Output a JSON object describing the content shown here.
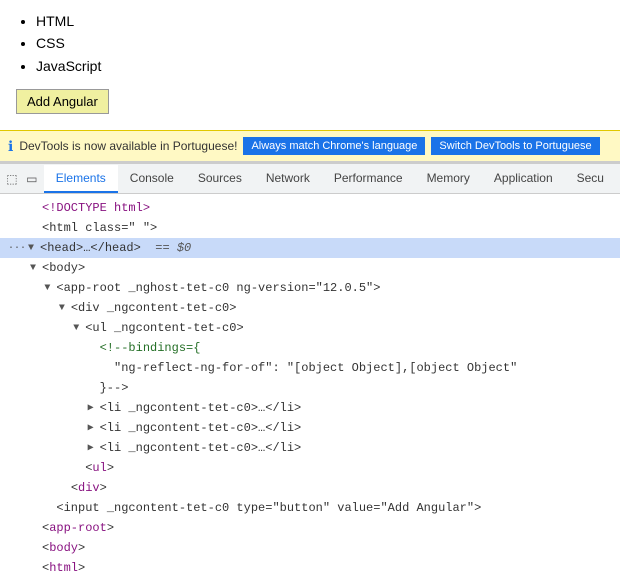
{
  "top": {
    "list_items": [
      "HTML",
      "CSS",
      "JavaScript"
    ],
    "add_button_label": "Add Angular"
  },
  "notification": {
    "text": "DevTools is now available in Portuguese!",
    "btn_match_label": "Always match Chrome's language",
    "btn_switch_label": "Switch DevTools to Portuguese"
  },
  "tabs": {
    "items": [
      "Elements",
      "Console",
      "Sources",
      "Network",
      "Performance",
      "Memory",
      "Application",
      "Secu"
    ]
  },
  "code": {
    "lines": [
      {
        "indent": 0,
        "arrow": "none",
        "content": "<!DOCTYPE html>"
      },
      {
        "indent": 0,
        "arrow": "none",
        "content": "<html class=\" \">"
      },
      {
        "indent": 0,
        "arrow": "expanded",
        "highlight": true,
        "content": "<head>…</head>",
        "suffix": " == $0"
      },
      {
        "indent": 0,
        "arrow": "expanded",
        "content": "<body>"
      },
      {
        "indent": 1,
        "arrow": "expanded",
        "content": "<app-root _nghost-tet-c0 ng-version=\"12.0.5\">"
      },
      {
        "indent": 2,
        "arrow": "expanded",
        "content": "<div _ngcontent-tet-c0>"
      },
      {
        "indent": 3,
        "arrow": "expanded",
        "content": "<ul _ngcontent-tet-c0>"
      },
      {
        "indent": 4,
        "arrow": "none",
        "content": "<!--bindings={"
      },
      {
        "indent": 5,
        "arrow": "none",
        "content": "\"ng-reflect-ng-for-of\": \"[object Object],[object Object\""
      },
      {
        "indent": 4,
        "arrow": "none",
        "content": "}-->"
      },
      {
        "indent": 4,
        "arrow": "collapsed",
        "content": "<li _ngcontent-tet-c0>…</li>"
      },
      {
        "indent": 4,
        "arrow": "collapsed",
        "content": "<li _ngcontent-tet-c0>…</li>"
      },
      {
        "indent": 4,
        "arrow": "collapsed",
        "content": "<li _ngcontent-tet-c0>…</li>"
      },
      {
        "indent": 3,
        "arrow": "none",
        "content": "</ul>"
      },
      {
        "indent": 2,
        "arrow": "none",
        "content": "</div>"
      },
      {
        "indent": 1,
        "arrow": "none",
        "content": "<input _ngcontent-tet-c0 type=\"button\" value=\"Add Angular\">"
      },
      {
        "indent": 0,
        "arrow": "none",
        "content": "</app-root>"
      },
      {
        "indent": 0,
        "arrow": "none",
        "content": "</body>"
      },
      {
        "indent": 0,
        "arrow": "none",
        "content": "</html>"
      }
    ]
  }
}
